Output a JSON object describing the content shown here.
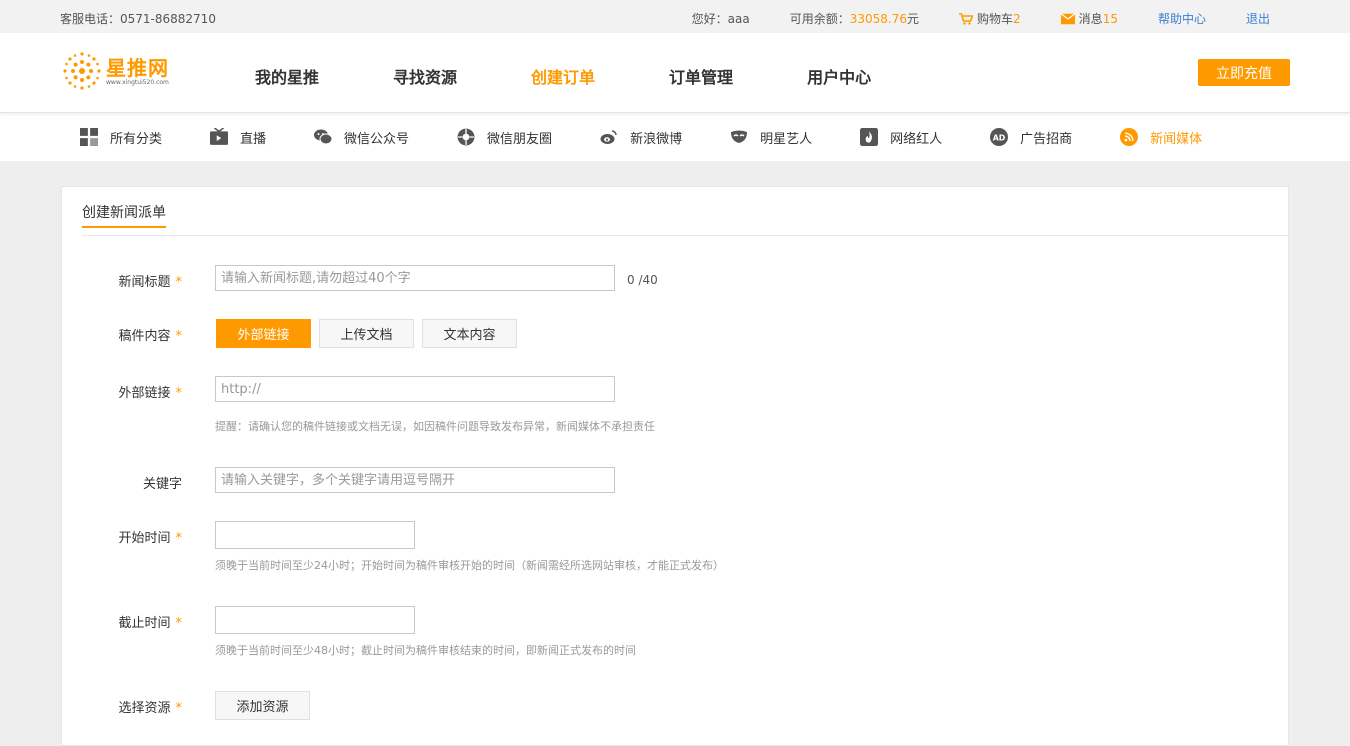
{
  "topbar": {
    "service": "客服电话：0571-86882710",
    "greeting": "您好：aaa",
    "balance_label": "可用余额：",
    "balance_value": "33058.76",
    "balance_unit": "元",
    "cart_label": "购物车",
    "cart_count": "2",
    "msg_label": "消息",
    "msg_count": "15",
    "help": "帮助中心",
    "logout": "退出"
  },
  "logo": {
    "name": "星推网",
    "url": "www.xingtui520.com"
  },
  "nav": [
    "我的星推",
    "寻找资源",
    "创建订单",
    "订单管理",
    "用户中心"
  ],
  "nav_active": 2,
  "recharge": "立即充值",
  "categories": [
    {
      "label": "所有分类",
      "icon": "grid-icon"
    },
    {
      "label": "直播",
      "icon": "tv-icon"
    },
    {
      "label": "微信公众号",
      "icon": "wechat-icon"
    },
    {
      "label": "微信朋友圈",
      "icon": "moments-icon"
    },
    {
      "label": "新浪微博",
      "icon": "weibo-icon"
    },
    {
      "label": "明星艺人",
      "icon": "star-mask-icon"
    },
    {
      "label": "网络红人",
      "icon": "flame-icon"
    },
    {
      "label": "广告招商",
      "icon": "ad-icon"
    },
    {
      "label": "新闻媒体",
      "icon": "rss-icon"
    }
  ],
  "colors": {
    "accent": "#ff9900",
    "link": "#3a7fd1"
  },
  "form": {
    "title": "创建新闻派单",
    "news_title_label": "新闻标题",
    "news_title_placeholder": "请输入新闻标题,请勿超过40个字",
    "news_title_count": "0 /40",
    "content_label": "稿件内容",
    "content_tabs": [
      "外部链接",
      "上传文档",
      "文本内容"
    ],
    "link_label": "外部链接",
    "link_placeholder": "http://",
    "link_hint": "提醒：请确认您的稿件链接或文档无误，如因稿件问题导致发布异常，新闻媒体不承担责任",
    "keyword_label": "关键字",
    "keyword_placeholder": "请输入关键字，多个关键字请用逗号隔开",
    "start_label": "开始时间",
    "start_hint": "须晚于当前时间至少24小时；开始时间为稿件审核开始的时间（新闻需经所选网站审核，才能正式发布）",
    "end_label": "截止时间",
    "end_hint": "须晚于当前时间至少48小时；截止时间为稿件审核结束的时间，即新闻正式发布的时间",
    "resource_label": "选择资源",
    "add_resource": "添加资源",
    "required_mark": "*"
  }
}
